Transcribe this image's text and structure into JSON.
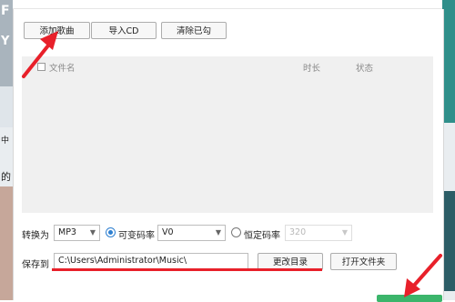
{
  "toolbar": {
    "add_song": "添加歌曲",
    "import_cd": "导入CD",
    "clear_checked": "清除已勾"
  },
  "list": {
    "columns": {
      "name": "文件名",
      "duration": "时长",
      "status": "状态"
    },
    "rows": []
  },
  "convert": {
    "label": "转换为",
    "format": "MP3",
    "vbr_label": "可变码率",
    "vbr_value": "V0",
    "vbr_selected": true,
    "cbr_label": "恒定码率",
    "cbr_value": "320",
    "cbr_selected": false
  },
  "save": {
    "label": "保存到",
    "path": "C:\\Users\\Administrator\\Music\\",
    "change_dir": "更改目录",
    "open_folder": "打开文件夹"
  },
  "background": {
    "left_fragments": [
      "F",
      "Y",
      "中",
      "的"
    ]
  },
  "colors": {
    "annotation_red": "#e8202a",
    "accent_blue": "#2d7fd0",
    "start_green": "#3bb56b"
  }
}
